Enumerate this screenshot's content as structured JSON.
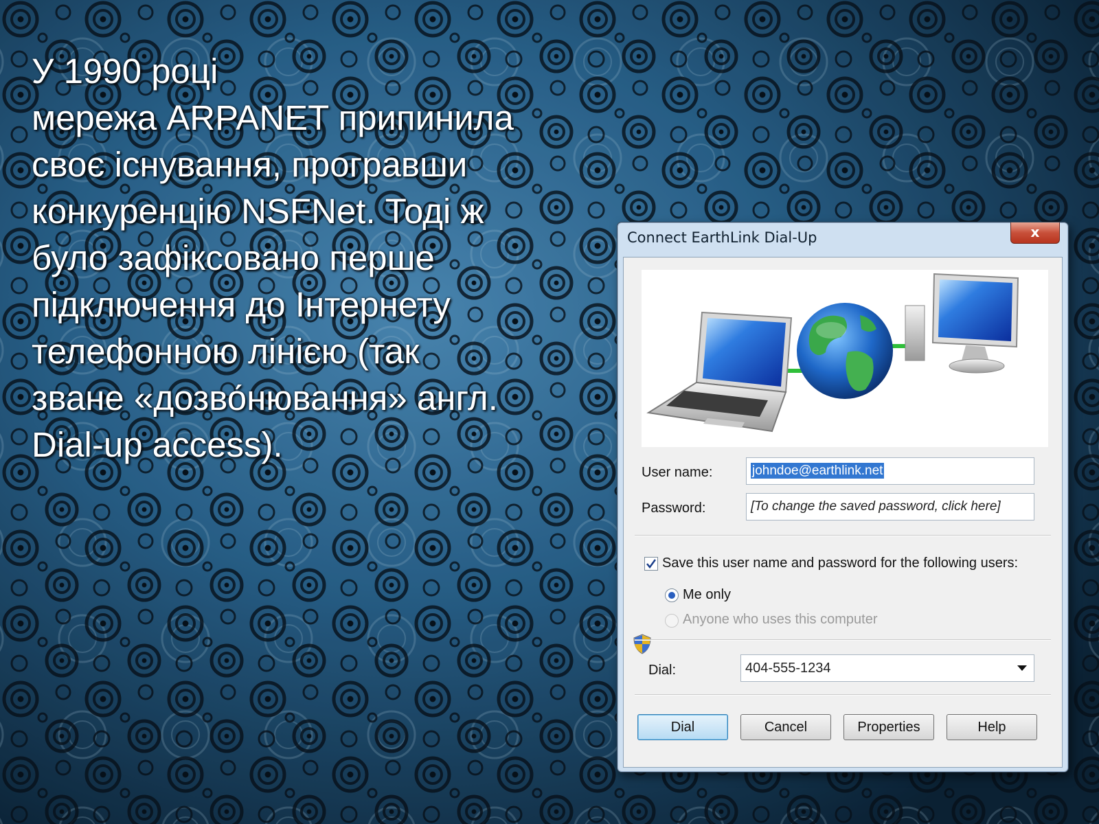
{
  "slide": {
    "lines": [
      "У 1990 році",
      "мережа ARPANET припинила",
      "своє існування, програвши",
      "конкуренцію NSFNet. Тоді ж",
      "було зафіксовано перше",
      "підключення до Інтернету",
      "телефонною лінією (так",
      "зване «дозво́нювання» англ.",
      "Dial-up access)."
    ]
  },
  "dialog": {
    "title": "Connect EarthLink Dial-Up",
    "close_label": "x",
    "user_name_label": "User name:",
    "user_name_value": "johndoe@earthlink.net",
    "password_label": "Password:",
    "password_value": "[To change the saved password, click here]",
    "save_label": "Save this user name and password for the following users:",
    "save_checked": true,
    "radio_me_only": "Me only",
    "radio_anyone": "Anyone who uses this computer",
    "dial_label": "Dial:",
    "dial_value": "404-555-1234",
    "buttons": {
      "dial": "Dial",
      "cancel": "Cancel",
      "properties": "Properties",
      "help": "Help"
    }
  },
  "colors": {
    "background": "#1d4f77",
    "dialog_frame": "#cfe0f1",
    "selection": "#3277d1"
  },
  "icons": [
    "laptop-icon",
    "globe-icon",
    "desktop-monitor-icon",
    "shield-icon",
    "checkmark-icon",
    "chevron-down-icon"
  ]
}
